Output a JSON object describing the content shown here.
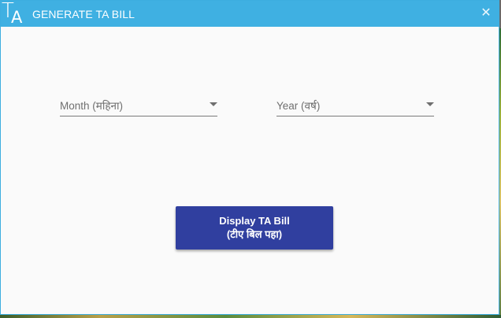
{
  "window": {
    "logo_t": "T",
    "logo_a": "A",
    "title": "GENERATE TA BILL",
    "close_glyph": "✕"
  },
  "form": {
    "month_label": "Month (महिना)",
    "year_label": "Year (वर्ष)"
  },
  "actions": {
    "display_line1": "Display TA Bill",
    "display_line2": "(टीए बिल पहा)"
  },
  "icons": {
    "close": "close-icon",
    "dropdown": "caret-down-icon"
  },
  "colors": {
    "titlebar": "#3fb0e2",
    "primary_button": "#303f9f",
    "background": "#fafafa"
  }
}
